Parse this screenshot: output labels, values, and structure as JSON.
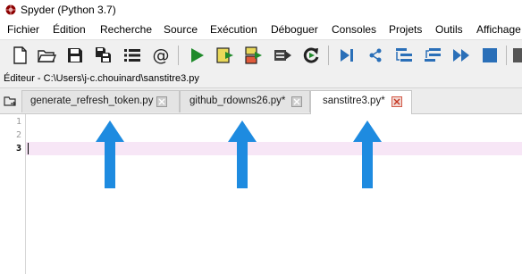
{
  "window": {
    "title": "Spyder (Python 3.7)"
  },
  "menu": [
    {
      "label": "Fichier",
      "name": "menu-fichier"
    },
    {
      "label": "Édition",
      "name": "menu-edition"
    },
    {
      "label": "Recherche",
      "name": "menu-recherche"
    },
    {
      "label": "Source",
      "name": "menu-source"
    },
    {
      "label": "Exécution",
      "name": "menu-execution"
    },
    {
      "label": "Déboguer",
      "name": "menu-deboguer"
    },
    {
      "label": "Consoles",
      "name": "menu-consoles"
    },
    {
      "label": "Projets",
      "name": "menu-projets"
    },
    {
      "label": "Outils",
      "name": "menu-outils"
    },
    {
      "label": "Affichage",
      "name": "menu-affichage"
    }
  ],
  "toolbar": {
    "icons": [
      "new-file-icon",
      "open-folder-icon",
      "save-icon",
      "save-all-icon",
      "outline-list-icon",
      "at-sign-icon",
      "run-icon",
      "run-cell-icon",
      "run-cell-advance-icon",
      "run-selection-icon",
      "rerun-icon",
      "debug-icon",
      "step-icon",
      "step-into-icon",
      "step-return-icon",
      "continue-icon",
      "stop-debug-icon"
    ]
  },
  "editor": {
    "path_text": "Éditeur - C:\\Users\\j-c.chouinard\\sanstitre3.py",
    "tabs": [
      {
        "label": "generate_refresh_token.py",
        "active": false
      },
      {
        "label": "github_rdowns26.py*",
        "active": false
      },
      {
        "label": "sanstitre3.py*",
        "active": true
      }
    ],
    "line_numbers": [
      "1",
      "2",
      "3"
    ],
    "current_line": 3
  },
  "annotation": {
    "arrow_color": "#1e8be0"
  }
}
